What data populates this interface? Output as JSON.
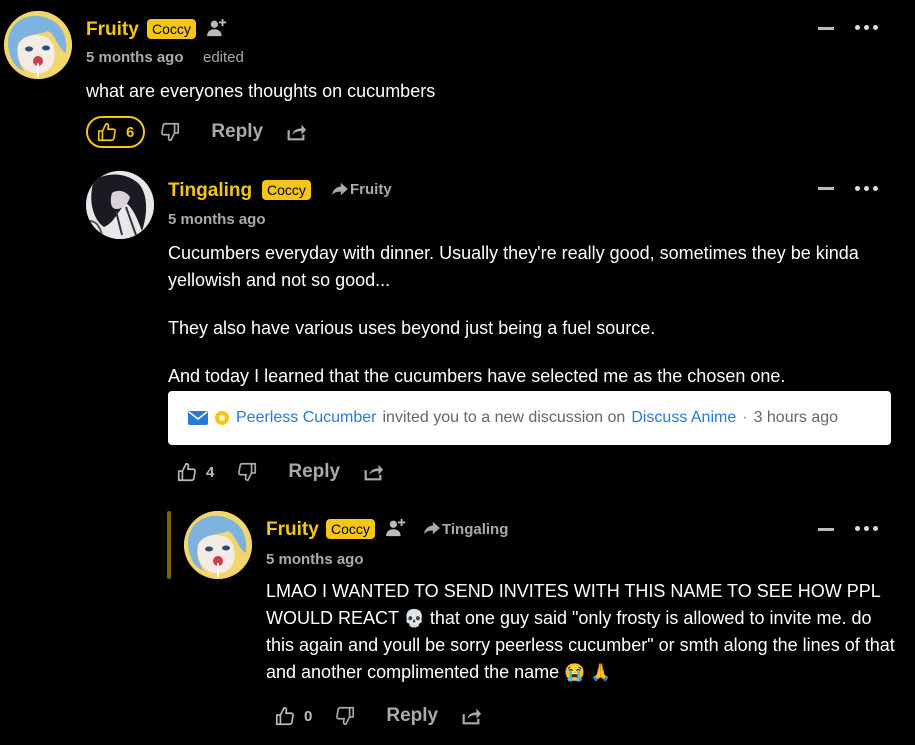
{
  "comments": [
    {
      "author": "Fruity",
      "badge": "Coccy",
      "timestamp": "5 months ago",
      "edited": "edited",
      "text": "what are everyones thoughts on cucumbers",
      "likes": "6",
      "reply_label": "Reply"
    },
    {
      "author": "Tingaling",
      "badge": "Coccy",
      "reply_to": "Fruity",
      "timestamp": "5 months ago",
      "paragraphs": [
        "Cucumbers everyday with dinner. Usually they're really good, sometimes they be kinda yellowish and not so good...",
        "They also have various uses beyond just being a fuel source.",
        "And today I learned that the cucumbers have selected me as the chosen one."
      ],
      "invite": {
        "sender": "Peerless Cucumber",
        "middle": "invited you to a new discussion on",
        "site": "Discuss Anime",
        "separator": "·",
        "time": "3 hours ago"
      },
      "likes": "4",
      "reply_label": "Reply"
    },
    {
      "author": "Fruity",
      "badge": "Coccy",
      "reply_to": "Tingaling",
      "timestamp": "5 months ago",
      "text_part1": "LMAO I WANTED TO SEND INVITES WITH THIS NAME TO SEE HOW PPL WOULD REACT",
      "emoji1": "💀",
      "text_part2": "that one guy said \"only frosty is allowed to invite me. do this again and youll be sorry peerless cucumber\" or smth along the lines of that and another complimented the name",
      "emoji2": "😭",
      "emoji3": "🙏",
      "likes": "0",
      "reply_label": "Reply"
    }
  ],
  "colors": {
    "accent": "#f5c518",
    "background": "#000000",
    "link": "#2a7ad2"
  },
  "icons": [
    "thumbs-up-icon",
    "thumbs-down-icon",
    "share-icon",
    "add-user-icon",
    "reply-arrow-icon",
    "mail-icon",
    "collapse-icon",
    "more-icon"
  ]
}
